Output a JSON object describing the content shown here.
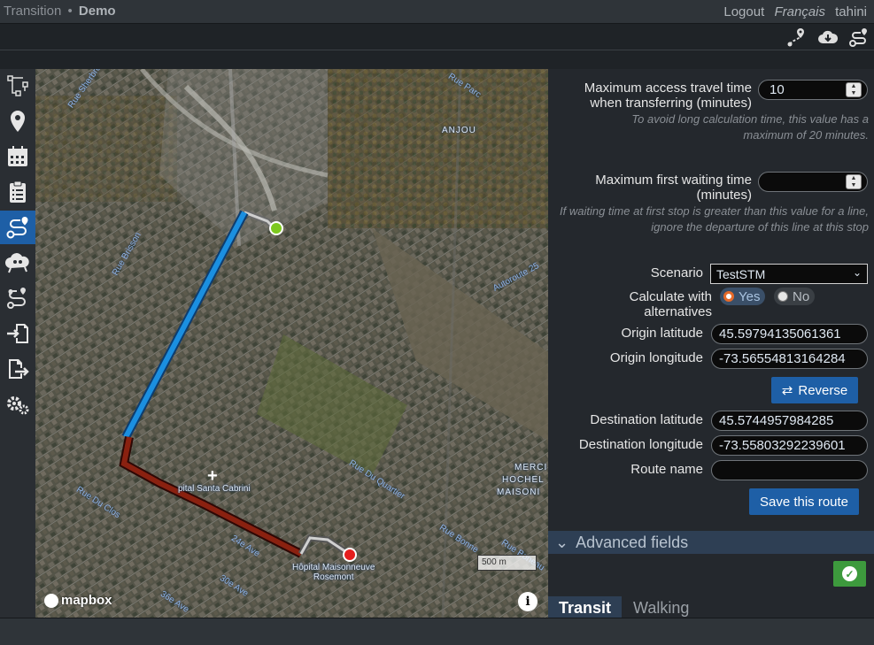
{
  "header": {
    "app_name": "Transition",
    "separator": "•",
    "project": "Demo",
    "logout": "Logout",
    "language": "Français",
    "username": "tahini"
  },
  "toolbar_icons": [
    "route-pin-icon",
    "cloud-download-icon",
    "routing-icon"
  ],
  "sidebar": {
    "items": [
      {
        "icon": "network-icon",
        "active": false
      },
      {
        "icon": "map-pin-icon",
        "active": false
      },
      {
        "icon": "calendar-icon",
        "active": false
      },
      {
        "icon": "clipboard-icon",
        "active": false
      },
      {
        "icon": "routing-icon",
        "active": true
      },
      {
        "icon": "accessibility-map-icon",
        "active": false
      },
      {
        "icon": "od-pairs-icon",
        "active": false
      },
      {
        "icon": "import-icon",
        "active": false
      },
      {
        "icon": "export-icon",
        "active": false
      },
      {
        "icon": "settings-icon",
        "active": false
      }
    ]
  },
  "map": {
    "labels": {
      "anjou": "ANJOU",
      "hospital_cabrini": "pital Santa Cabrini",
      "hospital_maisonneuve": "Hôpital Maisonneuve\nRosemont",
      "merci": "MERCI",
      "hochel": "HOCHEL",
      "maison": "MAISONI",
      "rue_du_quartier": "Rue Du Quartier",
      "autoroute": "Autoroute 25",
      "rue_parc": "Rue Parc",
      "rue_sherbrooke": "Rue Sherbrooke",
      "rue_brisson": "Rue Brisson",
      "rue_du_clos": "Rue Du Clos",
      "ave_24": "24e Ave",
      "ave_30": "30e Ave",
      "ave_36": "36e Ave",
      "rue_bonne": "Rue Bonne",
      "rue_boneau": "Rue Boneau"
    },
    "scale": "500 m",
    "attribution": "mapbox",
    "info": "i"
  },
  "form": {
    "max_access_label": "Maximum access travel time when transferring (minutes)",
    "max_access_value": "10",
    "max_access_help": "To avoid long calculation time, this value has a maximum of 20 minutes.",
    "max_wait_label": "Maximum first waiting time (minutes)",
    "max_wait_value": "",
    "max_wait_help": "If waiting time at first stop is greater than this value for a line, ignore the departure of this line at this stop",
    "scenario_label": "Scenario",
    "scenario_value": "TestSTM",
    "alternatives_label": "Calculate with alternatives",
    "alt_yes": "Yes",
    "alt_no": "No",
    "alt_selected": "Yes",
    "origin_lat_label": "Origin latitude",
    "origin_lat_value": "45.59794135061361",
    "origin_lon_label": "Origin longitude",
    "origin_lon_value": "-73.56554813164284",
    "reverse_label": "Reverse",
    "dest_lat_label": "Destination latitude",
    "dest_lat_value": "45.5744957984285",
    "dest_lon_label": "Destination longitude",
    "dest_lon_value": "-73.55803292239601",
    "route_name_label": "Route name",
    "route_name_value": "",
    "save_label": "Save this route",
    "advanced_label": "Advanced fields"
  },
  "tabs": [
    {
      "label": "Transit",
      "active": true
    },
    {
      "label": "Walking",
      "active": false
    }
  ],
  "colors": {
    "accent": "#1e5fa6",
    "transit_route": "#1b7fd0",
    "walk_route": "#7a1a10",
    "origin_marker": "#7dc81f",
    "destination_marker": "#e51d1d",
    "confirm": "#3d9a3d"
  }
}
